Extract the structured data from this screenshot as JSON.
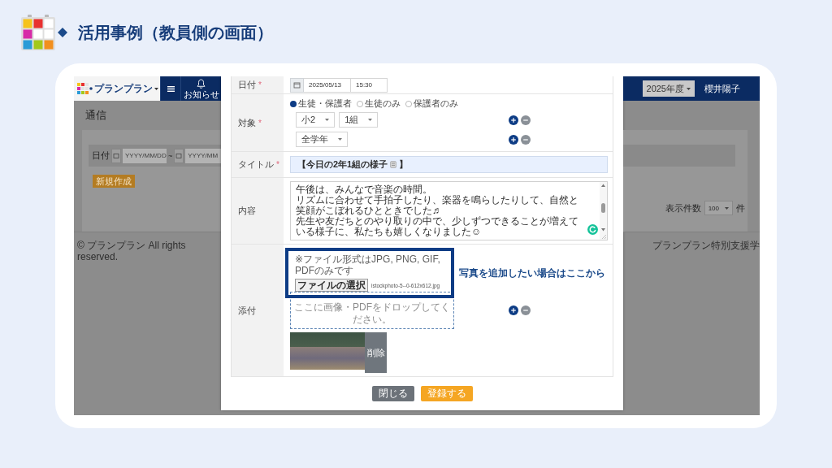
{
  "header": {
    "title": "活用事例（教員側の画面）"
  },
  "app": {
    "navbar": {
      "brand": "プランプラン",
      "notice": "お知らせ",
      "year": "2025年度",
      "user": "櫻井陽子"
    },
    "page_title": "通信",
    "filter": {
      "label": "日付",
      "from_placeholder": "YYYY/MM/DD",
      "separator": "~",
      "to_placeholder": "YYYY/MM"
    },
    "new_button": "新規作成",
    "page_size": {
      "label": "表示件数",
      "value": "100",
      "unit": "件"
    },
    "footer": {
      "copyright": "© プランプラン All rights reserved.",
      "school": "プランプラン特別支援学"
    }
  },
  "modal": {
    "date": {
      "label": "日付",
      "mark": "*",
      "date": "2025/05/13",
      "time": "15:30"
    },
    "target": {
      "label": "対象",
      "mark": "*",
      "audience": [
        {
          "label": "生徒・保護者",
          "selected": true
        },
        {
          "label": "生徒のみ",
          "selected": false
        },
        {
          "label": "保護者のみ",
          "selected": false
        }
      ],
      "rows": [
        {
          "selects": [
            "小2",
            "1組"
          ]
        },
        {
          "selects": [
            "全学年"
          ]
        }
      ]
    },
    "title": {
      "label": "タイトル",
      "mark": "*",
      "value": [
        "【今日の2年1組の様子",
        "】"
      ]
    },
    "content": {
      "label": "内容",
      "lines": [
        "午後は、みんなで音楽の時間。",
        "リズムに合わせて手拍子したり、楽器を鳴らしたりして、自然と笑顔がこぼれるひとときでした♬",
        "先生や友だちとのやり取りの中で、少しずつできることが増えている様子に、私たちも嬉しくなりました☺"
      ]
    },
    "attachment": {
      "label": "添付",
      "note": "※ファイル形式はJPG, PNG, GIF, PDFのみです",
      "file_button": "ファイルの選択",
      "file_name": "istockphoto-5--0-612x612.jpg",
      "callout": "写真を追加したい場合はここから",
      "drop_text": "ここに画像・PDFをドロップしてください。",
      "delete_button": "削除"
    },
    "buttons": [
      {
        "label": "閉じる",
        "kind": "secondary"
      },
      {
        "label": "登録する",
        "kind": "primary"
      }
    ]
  }
}
